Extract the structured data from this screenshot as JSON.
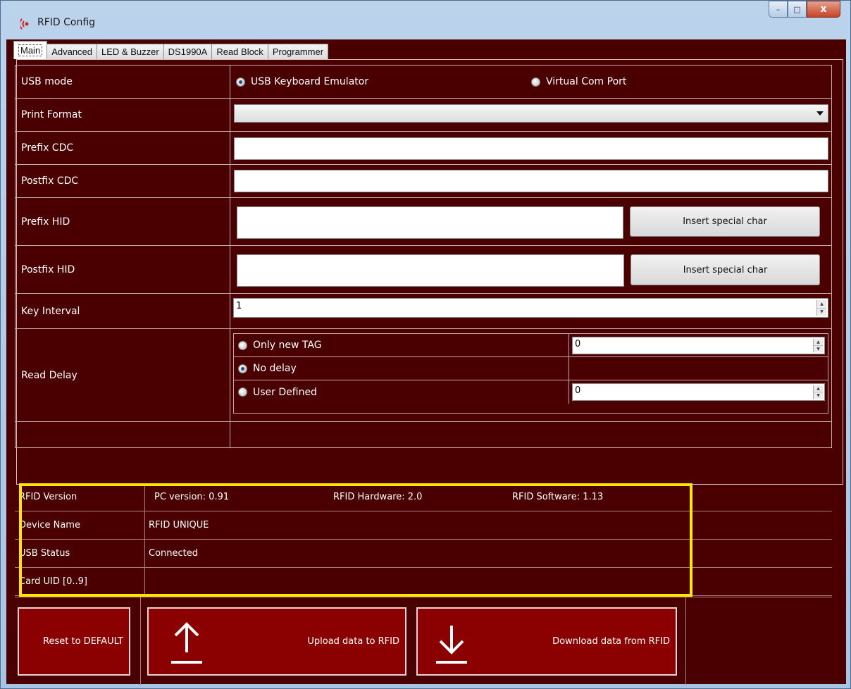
{
  "window": {
    "title": "RFID Config",
    "minimize": "–",
    "maximize": "□",
    "close": "x"
  },
  "tabs": [
    {
      "label": "Main"
    },
    {
      "label": "Advanced"
    },
    {
      "label": "LED & Buzzer"
    },
    {
      "label": "DS1990A"
    },
    {
      "label": "Read Block"
    },
    {
      "label": "Programmer"
    }
  ],
  "main": {
    "usb_mode": {
      "label": "USB mode",
      "opt1": "USB Keyboard Emulator",
      "opt2": "Virtual Com Port",
      "selected": "USB Keyboard Emulator"
    },
    "print_format": {
      "label": "Print Format",
      "value": ""
    },
    "prefix_cdc": {
      "label": "Prefix CDC",
      "value": ""
    },
    "postfix_cdc": {
      "label": "Postfix CDC",
      "value": ""
    },
    "prefix_hid": {
      "label": "Prefix HID",
      "value": "",
      "button": "Insert special char"
    },
    "postfix_hid": {
      "label": "Postfix HID",
      "value": "",
      "button": "Insert special char"
    },
    "key_interval": {
      "label": "Key Interval",
      "value": "1"
    },
    "read_delay": {
      "label": "Read Delay",
      "opt_only_new": "Only new TAG",
      "opt_only_new_value": "0",
      "opt_no_delay": "No delay",
      "opt_user": "User Defined",
      "opt_user_value": "0",
      "selected": "No delay"
    }
  },
  "info": {
    "version_label": "RFID Version",
    "pc_version": "PC version: 0.91",
    "hw_version": "RFID Hardware: 2.0",
    "sw_version": "RFID Software: 1.13",
    "device_label": "Device Name",
    "device_value": "RFID UNIQUE",
    "usb_label": "USB Status",
    "usb_value": "Connected",
    "uid_label": "Card UID [0..9]",
    "uid_value": ""
  },
  "actions": {
    "reset": "Reset to DEFAULT",
    "upload": "Upload data to RFID",
    "download": "Download data from RFID"
  },
  "colors": {
    "background": "#4a0000",
    "button": "#8b0000",
    "highlight": "#ffe600"
  }
}
